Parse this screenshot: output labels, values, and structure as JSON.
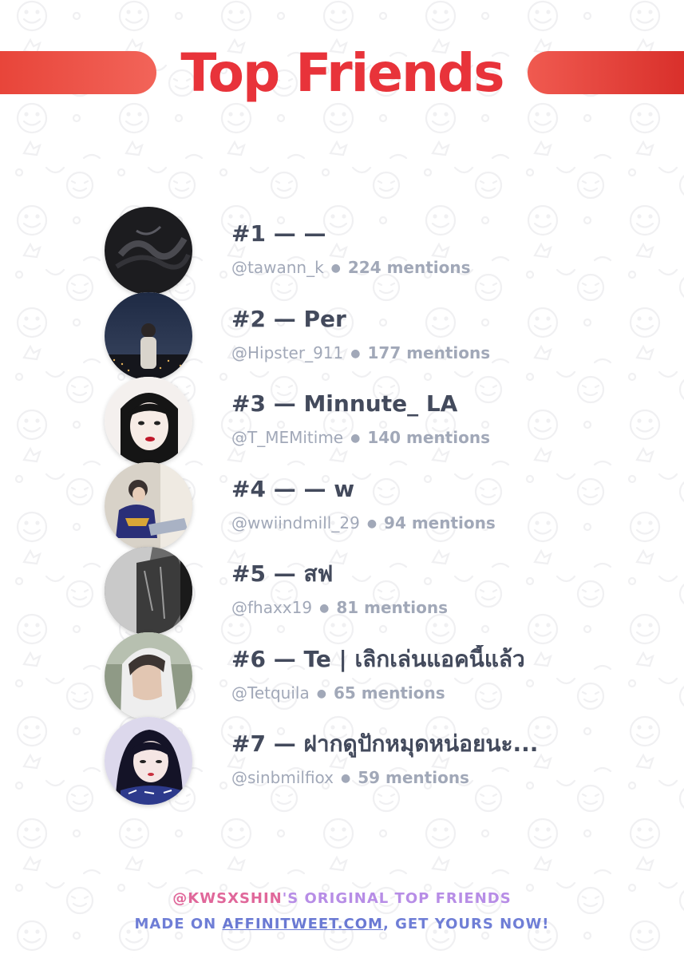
{
  "header": {
    "title": "Top Friends",
    "colors": {
      "title": "#e8333a",
      "bar": "#e8453a"
    }
  },
  "friends": [
    {
      "rank_name": "#1 — —",
      "handle": "@tawann_k",
      "mentions": "224 mentions",
      "avatar_icon": "dark-abstract-avatar"
    },
    {
      "rank_name": "#2 — Per",
      "handle": "@Hipster_911",
      "mentions": "177 mentions",
      "avatar_icon": "night-city-avatar"
    },
    {
      "rank_name": "#3 — Minnute_ LA",
      "handle": "@T_MEMitime",
      "mentions": "140 mentions",
      "avatar_icon": "portrait-illustration-avatar"
    },
    {
      "rank_name": "#4 — — w",
      "handle": "@wwiindmill_29",
      "mentions": "94 mentions",
      "avatar_icon": "person-sitting-avatar"
    },
    {
      "rank_name": "#5 — สฟ",
      "handle": "@fhaxx19",
      "mentions": "81 mentions",
      "avatar_icon": "grayscale-jacket-avatar"
    },
    {
      "rank_name": "#6 — Te | เลิกเล่นแอคนี้แล้ว",
      "handle": "@Tetquila",
      "mentions": "65 mentions",
      "avatar_icon": "white-hoodie-avatar"
    },
    {
      "rank_name": "#7 — ฝากดูปักหมุดหน่อยนะ...",
      "handle": "@sinbmilfiox",
      "mentions": "59 mentions",
      "avatar_icon": "anime-portrait-avatar"
    }
  ],
  "footer": {
    "username": "@KWSXSHIN",
    "line1_rest": "'S ORIGINAL TOP FRIENDS",
    "line2_prefix": "MADE ON ",
    "site": "AFFINITWEET.COM",
    "line2_suffix": ", GET YOURS NOW!"
  }
}
